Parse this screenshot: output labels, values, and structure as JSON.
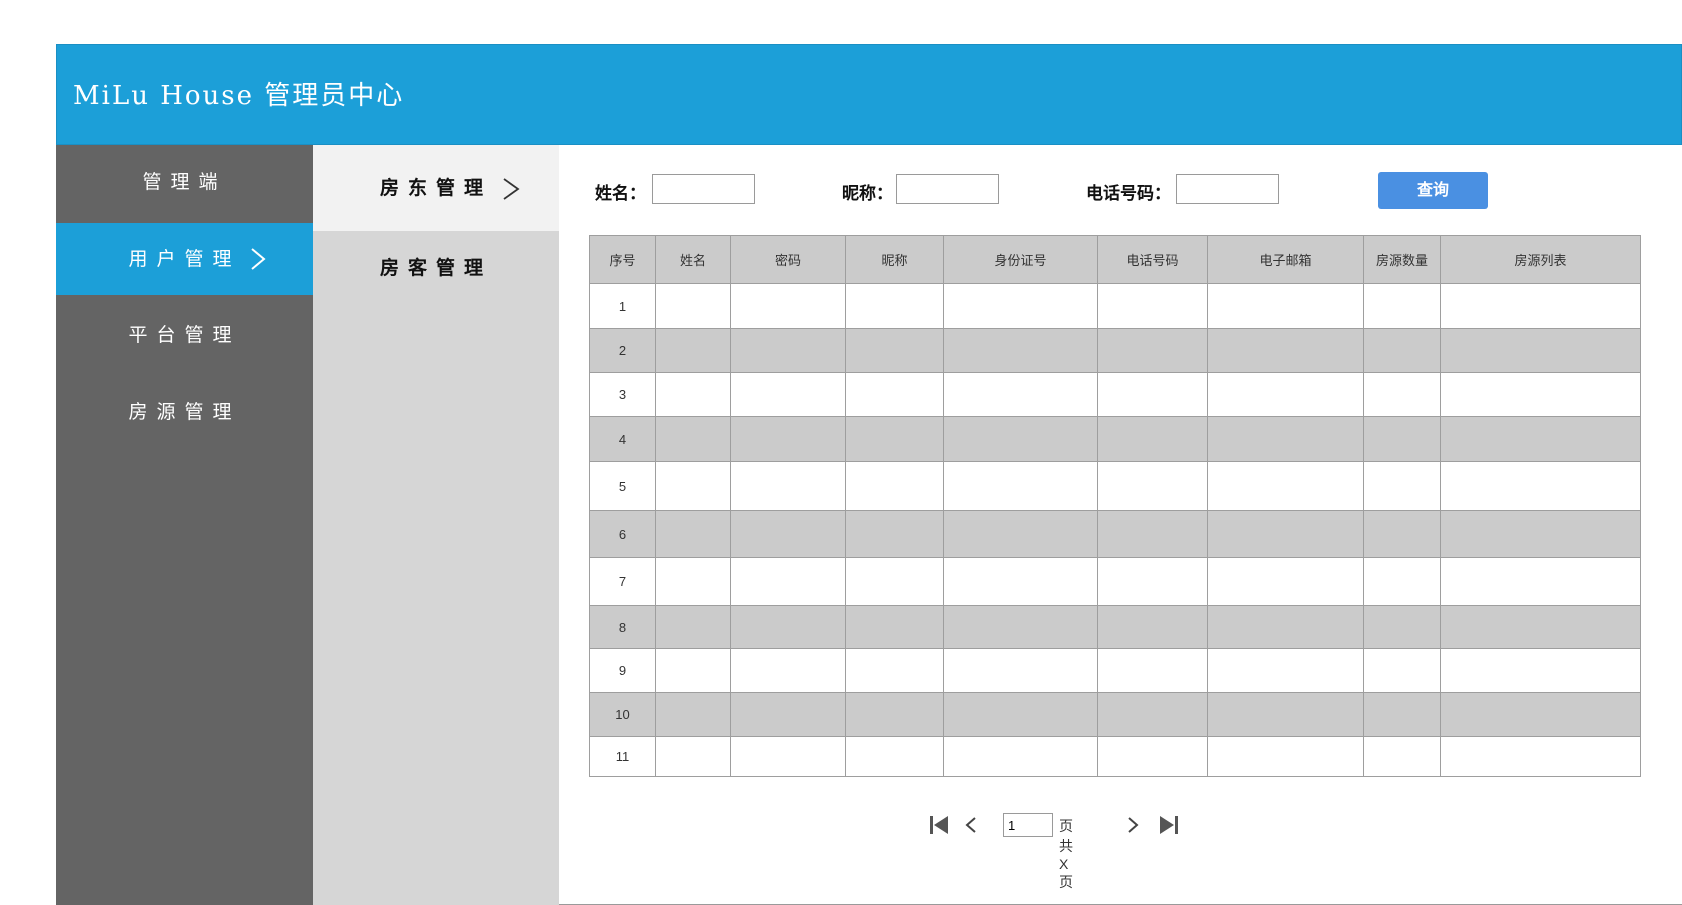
{
  "header": {
    "title": "MiLu House 管理员中心"
  },
  "sidebar": {
    "items": [
      {
        "label": "管理端"
      },
      {
        "label": "用户管理"
      },
      {
        "label": "平台管理"
      },
      {
        "label": "房源管理"
      }
    ],
    "active_index": 1
  },
  "subnav": {
    "items": [
      {
        "label": "房东管理"
      },
      {
        "label": "房客管理"
      }
    ],
    "active_index": 0
  },
  "search": {
    "name_label": "姓名：",
    "nickname_label": "昵称：",
    "phone_label": "电话号码：",
    "name_value": "",
    "nickname_value": "",
    "phone_value": "",
    "query_button": "查询"
  },
  "table": {
    "columns": [
      "序号",
      "姓名",
      "密码",
      "昵称",
      "身份证号",
      "电话号码",
      "电子邮箱",
      "房源数量",
      "房源列表"
    ],
    "rows": [
      "1",
      "2",
      "3",
      "4",
      "5",
      "6",
      "7",
      "8",
      "9",
      "10",
      "11"
    ]
  },
  "pagination": {
    "page_value": "1",
    "page_text": "页共X页"
  },
  "colors": {
    "header_bg": "#1c9fd8",
    "sidebar_bg": "#646464",
    "subnav_bg": "#d6d6d6",
    "button_bg": "#4a90e2",
    "row_alt_bg": "#cbcbcb"
  }
}
